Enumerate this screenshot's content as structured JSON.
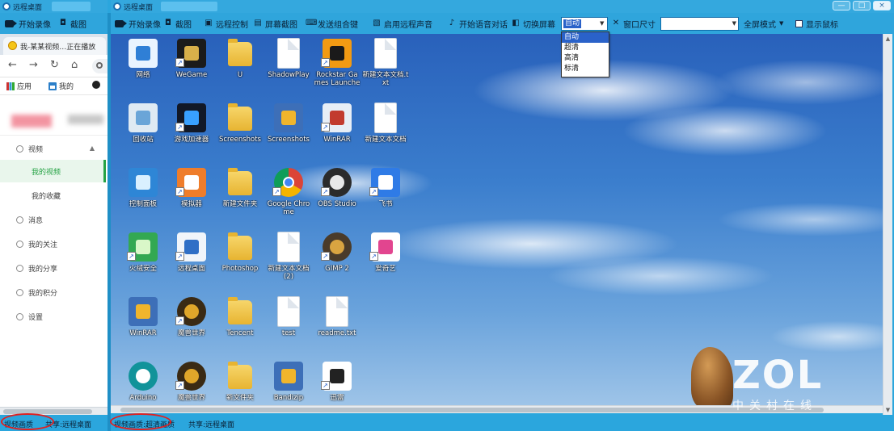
{
  "left_window": {
    "title": "远程桌面",
    "toolbar": {
      "record_label": "开始录像",
      "screenshot_label": "截图"
    },
    "browser": {
      "tab_title": "我-某某视频…正在播放",
      "bookmarks": [
        "应用",
        "我的"
      ],
      "menu": [
        {
          "label": "视频",
          "icon": "video-icon",
          "expanded": true
        },
        {
          "label": "我的视频",
          "active": true
        },
        {
          "label": "我的收藏"
        },
        {
          "label": "消息",
          "icon": "message-icon"
        },
        {
          "label": "我的关注",
          "icon": "user-icon"
        },
        {
          "label": "我的分享",
          "icon": "share-icon"
        },
        {
          "label": "我的积分",
          "icon": "points-icon"
        },
        {
          "label": "设置",
          "icon": "gear-icon"
        }
      ]
    },
    "status": {
      "quality": "视频画质",
      "share": "共享:远程桌面"
    }
  },
  "right_window": {
    "title": "远程桌面",
    "toolbar": {
      "record": "开始录像",
      "screenshot": "截图",
      "remote_control": "远程控制",
      "screen_capture": "屏幕截图",
      "send_keys": "发送组合键",
      "remote_sound": "启用远程声音",
      "voice_chat": "开始语音对话",
      "switch_screen": "切换屏幕",
      "quality": {
        "value": "自动",
        "options": [
          "自动",
          "超清",
          "高清",
          "标清"
        ]
      },
      "window_size": "窗口尺寸",
      "fullscreen": "全屏模式",
      "show_cursor": "显示鼠标"
    },
    "desktop": {
      "icon_rows": [
        [
          {
            "label": "网络",
            "icon": "network-icon",
            "kind": "app",
            "color": "#eaf4ff",
            "accent": "#2f7fd6",
            "shortcut": false
          },
          {
            "label": "WeGame",
            "icon": "wegame-icon",
            "kind": "app",
            "color": "#1b1b1b",
            "accent": "#d8b04a",
            "shortcut": true
          },
          {
            "label": "U",
            "icon": "folder-icon",
            "kind": "folder",
            "shortcut": false
          },
          {
            "label": "ShadowPlay",
            "icon": "file-icon",
            "kind": "file",
            "shortcut": false
          },
          {
            "label": "Rockstar Games Launcher",
            "icon": "rockstar-icon",
            "kind": "app",
            "color": "#f29a13",
            "accent": "#1a1a1a",
            "shortcut": true
          },
          {
            "label": "新建文本文档.txt",
            "icon": "file-icon",
            "kind": "file",
            "shortcut": false
          }
        ],
        [
          {
            "label": "回收站",
            "icon": "recycle-bin-icon",
            "kind": "app",
            "color": "#dfeaf3",
            "accent": "#6aa5d8",
            "shortcut": false
          },
          {
            "label": "游戏加速器",
            "icon": "accelerator-icon",
            "kind": "app",
            "color": "#121826",
            "accent": "#38a0ff",
            "shortcut": true
          },
          {
            "label": "Screenshots",
            "icon": "folder-icon",
            "kind": "folder",
            "shortcut": false
          },
          {
            "label": "Screenshots",
            "icon": "archive-icon",
            "kind": "app",
            "color": "#3d6fb8",
            "accent": "#f0b52c",
            "shortcut": false
          },
          {
            "label": "WinRAR",
            "icon": "tools-icon",
            "kind": "app",
            "color": "#e7eef6",
            "accent": "#c23b2e",
            "shortcut": true
          },
          {
            "label": "新建文本文档",
            "icon": "file-icon",
            "kind": "file",
            "shortcut": false
          }
        ],
        [
          {
            "label": "控制面板",
            "icon": "control-panel-icon",
            "kind": "app",
            "color": "#2e86d6",
            "accent": "#d9f0ff",
            "shortcut": false
          },
          {
            "label": "模拟器",
            "icon": "emulator-icon",
            "kind": "app",
            "color": "#ef7d2b",
            "accent": "#ffffff",
            "shortcut": true
          },
          {
            "label": "新建文件夹",
            "icon": "folder-icon",
            "kind": "folder",
            "shortcut": false
          },
          {
            "label": "Google Chrome",
            "icon": "chrome-icon",
            "kind": "chrome",
            "shortcut": true
          },
          {
            "label": "OBS Studio",
            "icon": "obs-icon",
            "kind": "app",
            "shape": "circle",
            "color": "#2b2b2b",
            "accent": "#e8e8e8",
            "shortcut": true
          },
          {
            "label": "飞书",
            "icon": "bird-icon",
            "kind": "app",
            "color": "#2f7be6",
            "accent": "#ffffff",
            "shortcut": true
          }
        ],
        [
          {
            "label": "火绒安全",
            "icon": "shield-icon",
            "kind": "app",
            "color": "#33a852",
            "accent": "#d9f7c8",
            "shortcut": true
          },
          {
            "label": "远程桌面",
            "icon": "remote-desktop-icon",
            "kind": "app",
            "color": "#f1f5fa",
            "accent": "#2f6fc6",
            "shortcut": true
          },
          {
            "label": "Photoshop",
            "icon": "folder-icon",
            "kind": "folder",
            "shortcut": false
          },
          {
            "label": "新建文本文档 (2)",
            "icon": "file-icon",
            "kind": "file",
            "shortcut": false
          },
          {
            "label": "GIMP 2",
            "icon": "gimp-icon",
            "kind": "app",
            "shape": "circle",
            "color": "#4a3b2a",
            "accent": "#d9a441",
            "shortcut": true
          },
          {
            "label": "爱奇艺",
            "icon": "video-app-icon",
            "kind": "app",
            "color": "#ffffff",
            "accent": "#e2458f",
            "shortcut": true
          }
        ],
        [
          {
            "label": "WinRAR",
            "icon": "archive-icon",
            "kind": "app",
            "color": "#3d6fb8",
            "accent": "#f0b52c",
            "shortcut": false
          },
          {
            "label": "魔兽世界",
            "icon": "wow-icon",
            "kind": "app",
            "shape": "circle",
            "color": "#3a2a14",
            "accent": "#e0a62a",
            "shortcut": true
          },
          {
            "label": "Tencent",
            "icon": "folder-icon",
            "kind": "folder",
            "shortcut": false
          },
          {
            "label": "test",
            "icon": "file-icon",
            "kind": "file",
            "shortcut": false
          },
          {
            "label": "readme.txt",
            "icon": "file-icon",
            "kind": "file",
            "shortcut": false
          }
        ],
        [
          {
            "label": "Arduino",
            "icon": "arduino-icon",
            "kind": "app",
            "shape": "circle",
            "color": "#11939a",
            "accent": "#ffffff",
            "shortcut": false
          },
          {
            "label": "魔兽世界",
            "icon": "wow-icon",
            "kind": "app",
            "shape": "circle",
            "color": "#3a2a14",
            "accent": "#e0a62a",
            "shortcut": true
          },
          {
            "label": "新文件夹",
            "icon": "folder-icon",
            "kind": "folder",
            "shortcut": false
          },
          {
            "label": "Bandizip",
            "icon": "archive-icon",
            "kind": "app",
            "color": "#3d6fb8",
            "accent": "#f0b52c",
            "shortcut": false
          },
          {
            "label": "迅雷",
            "icon": "xunlei-icon",
            "kind": "app",
            "color": "#ffffff",
            "accent": "#222222",
            "shortcut": true
          }
        ]
      ]
    },
    "watermark": {
      "logo": "ZOL",
      "subtitle": "中关村在线"
    },
    "status": {
      "quality": "视频画质:超清画质",
      "share": "共享:远程桌面"
    }
  }
}
